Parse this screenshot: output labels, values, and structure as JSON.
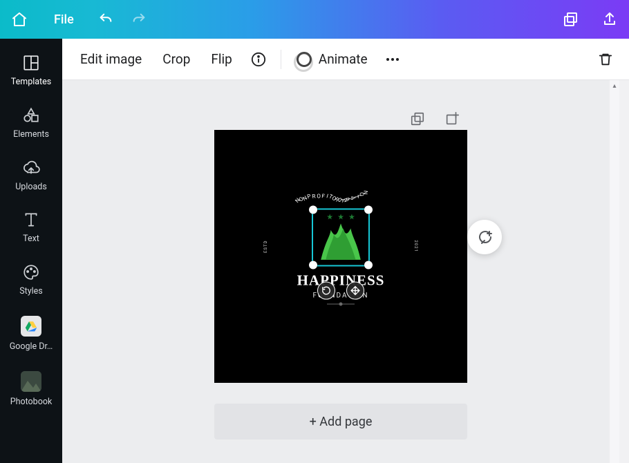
{
  "topbar": {
    "file_label": "File"
  },
  "sidebar": {
    "items": [
      {
        "label": "Templates"
      },
      {
        "label": "Elements"
      },
      {
        "label": "Uploads"
      },
      {
        "label": "Text"
      },
      {
        "label": "Styles"
      },
      {
        "label": "Google Dr…"
      },
      {
        "label": "Photobook"
      }
    ]
  },
  "context_toolbar": {
    "edit_image": "Edit image",
    "crop": "Crop",
    "flip": "Flip",
    "animate": "Animate"
  },
  "stage": {
    "add_page_label": "+ Add page"
  },
  "logo": {
    "arc_text": "NON PROFIT ORGANIZATION",
    "left_text": "ESTD",
    "right_text": "2021",
    "title": "HAPPINESS",
    "subtitle": "FOUNDATION"
  }
}
